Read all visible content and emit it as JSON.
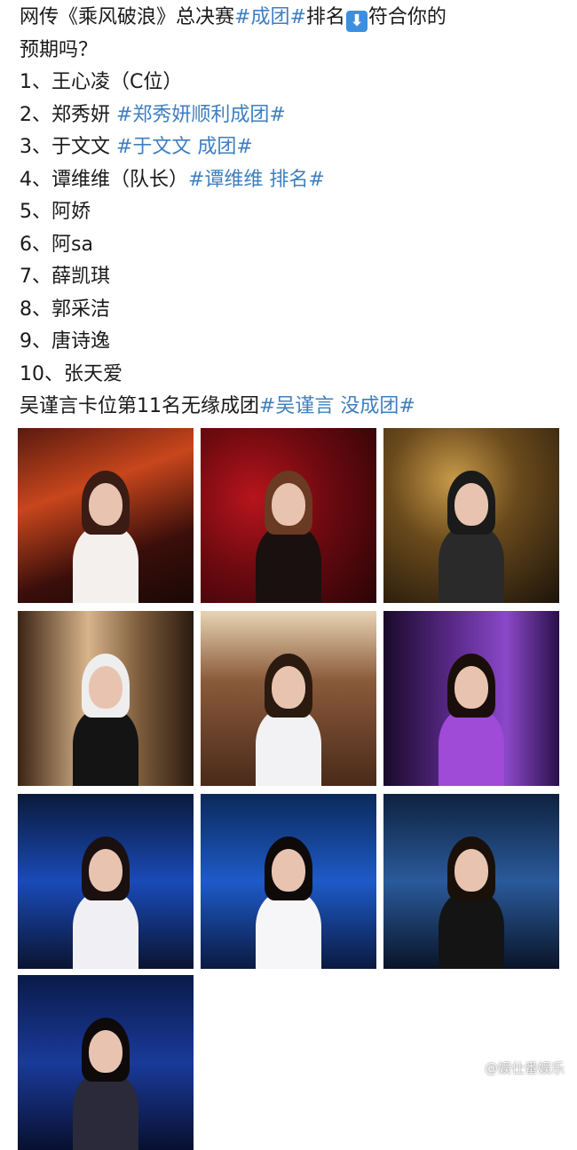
{
  "post": {
    "lines": [
      {
        "segments": [
          {
            "text": "网传《乘风破浪》总决赛",
            "tag": false
          },
          {
            "text": "#成团#",
            "tag": true
          },
          {
            "text": "排名",
            "tag": false
          },
          {
            "emoji": "⬇"
          },
          {
            "text": "符合你的",
            "tag": false
          }
        ]
      },
      {
        "segments": [
          {
            "text": "预期吗？",
            "tag": false
          }
        ]
      },
      {
        "segments": [
          {
            "text": "1、王心凌（C位）",
            "tag": false
          }
        ]
      },
      {
        "segments": [
          {
            "text": "2、郑秀妍 ",
            "tag": false
          },
          {
            "text": "#郑秀妍顺利成团#",
            "tag": true
          }
        ]
      },
      {
        "segments": [
          {
            "text": "3、于文文 ",
            "tag": false
          },
          {
            "text": "#于文文 成团#",
            "tag": true
          }
        ]
      },
      {
        "segments": [
          {
            "text": "4、谭维维（队长）",
            "tag": false
          },
          {
            "text": "#谭维维 排名#",
            "tag": true
          }
        ]
      },
      {
        "segments": [
          {
            "text": "5、阿娇",
            "tag": false
          }
        ]
      },
      {
        "segments": [
          {
            "text": "6、阿sa",
            "tag": false
          }
        ]
      },
      {
        "segments": [
          {
            "text": "7、薛凯琪",
            "tag": false
          }
        ]
      },
      {
        "segments": [
          {
            "text": "8、郭采洁",
            "tag": false
          }
        ]
      },
      {
        "segments": [
          {
            "text": "9、唐诗逸",
            "tag": false
          }
        ]
      },
      {
        "segments": [
          {
            "text": "10、张天爱",
            "tag": false
          }
        ]
      },
      {
        "segments": [
          {
            "text": "吴谨言卡位第11名无缘成团",
            "tag": false
          },
          {
            "text": "#吴谨言 没成团#",
            "tag": true
          }
        ]
      }
    ]
  },
  "photos": [
    {
      "name": "photo-singer-white-dress",
      "bg": "linear-gradient(160deg,#5a1a10 0%,#c8461c 35%,#3a0e0a 70%,#1a0806 100%)",
      "hair": "#3a1c14",
      "body": "#f4f0ee"
    },
    {
      "name": "photo-singer-red-roses",
      "bg": "radial-gradient(circle at 30% 40%,#b8141c 0%,#6e0a10 45%,#2a0406 100%)",
      "hair": "#6a3a22",
      "body": "#1a1010"
    },
    {
      "name": "photo-stage-gold",
      "bg": "radial-gradient(circle at 40% 30%,#c89a4a 0%,#6a4a1c 40%,#1c140a 100%)",
      "hair": "#1a1a1a",
      "body": "#2a2a2a"
    },
    {
      "name": "photo-singer-white-cap",
      "bg": "linear-gradient(90deg,#3a2414 0%,#d8b48a 40%,#7a5a3a 70%,#2a1a10 100%)",
      "hair": "#eeeeee",
      "body": "#141414"
    },
    {
      "name": "photo-singer-black-white-dress",
      "bg": "linear-gradient(180deg,#e8d4b4 0%,#8a5a3a 40%,#4a2a1a 100%)",
      "hair": "#2a1a10",
      "body": "#f2f2f4"
    },
    {
      "name": "photo-singer-purple-gloves",
      "bg": "linear-gradient(90deg,#1a0a2a 0%,#5a2a8a 40%,#8a48c8 70%,#2a104a 100%)",
      "hair": "#1a0e0a",
      "body": "#a04ad8"
    },
    {
      "name": "photo-singer-blue-stage",
      "bg": "linear-gradient(180deg,#0a1a3a 0%,#1a4ab8 50%,#0a1430 100%)",
      "hair": "#1a1010",
      "body": "#f0f0f4"
    },
    {
      "name": "photo-singer-short-hair",
      "bg": "linear-gradient(180deg,#0a2a5a 0%,#1e5ac8 50%,#0a1a40 100%)",
      "hair": "#0e0a0a",
      "body": "#f6f6f8"
    },
    {
      "name": "photo-singer-microphone",
      "bg": "linear-gradient(180deg,#0e2240 0%,#2a5a9a 50%,#0a1428 100%)",
      "hair": "#1a100a",
      "body": "#141414"
    },
    {
      "name": "photo-singer-braids",
      "bg": "linear-gradient(180deg,#0a1a4a 0%,#1a3a9a 50%,#081030 100%)",
      "hair": "#0e0a0a",
      "body": "#2a2a3a"
    }
  ],
  "watermark": {
    "text": "@娱仕番娱乐",
    "icon": "watermark-logo-icon"
  }
}
